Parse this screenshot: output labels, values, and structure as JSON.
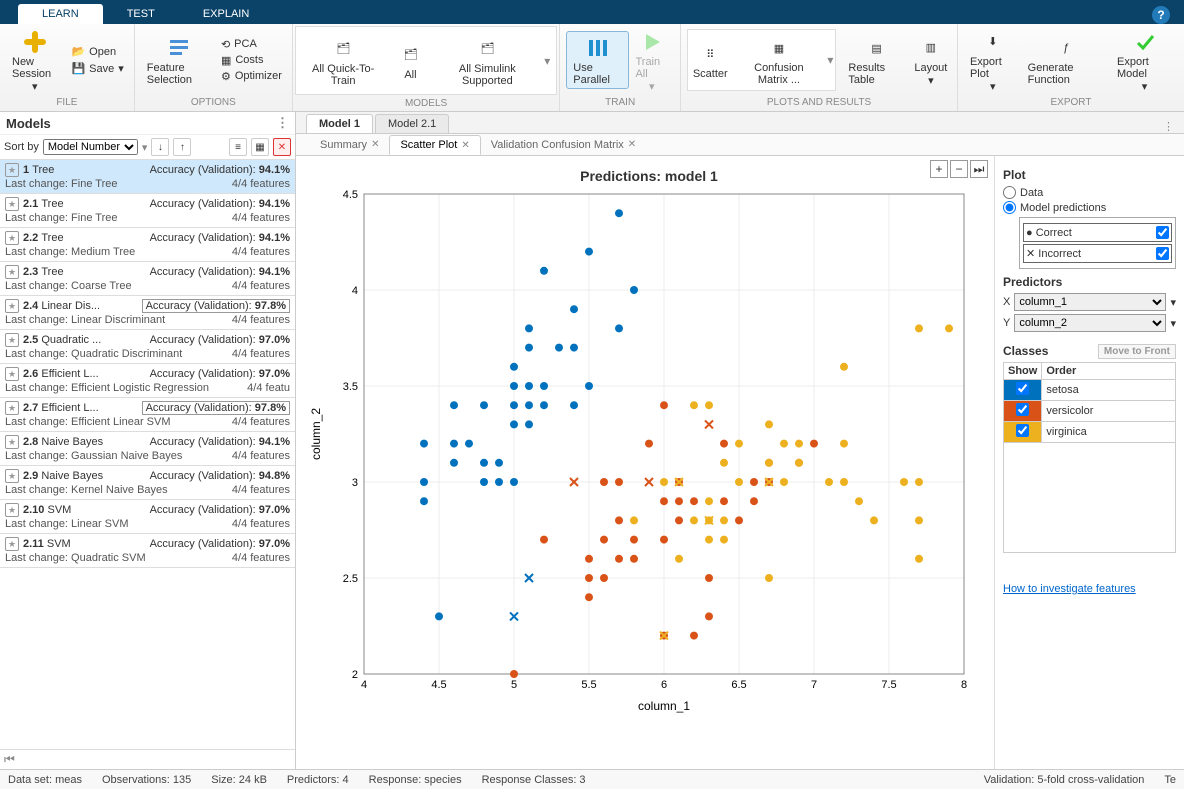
{
  "tabs": {
    "learn": "LEARN",
    "test": "TEST",
    "explain": "EXPLAIN"
  },
  "ribbon": {
    "file": {
      "new": "New Session",
      "open": "Open",
      "save": "Save",
      "label": "FILE"
    },
    "options": {
      "feature": "Feature Selection",
      "pca": "PCA",
      "costs": "Costs",
      "optimizer": "Optimizer",
      "label": "OPTIONS"
    },
    "models": {
      "all_quick": "All Quick-To-Train",
      "all": "All",
      "all_sim": "All Simulink Supported",
      "label": "MODELS"
    },
    "train": {
      "use_parallel": "Use Parallel",
      "train_all": "Train All",
      "label": "TRAIN"
    },
    "plots": {
      "scatter": "Scatter",
      "confusion": "Confusion Matrix  ...",
      "results": "Results Table",
      "layout": "Layout",
      "label": "PLOTS AND RESULTS"
    },
    "export": {
      "export_plot": "Export Plot",
      "gen_fn": "Generate Function",
      "export_model": "Export Model",
      "label": "EXPORT"
    }
  },
  "models_pane": {
    "title": "Models",
    "sort_label": "Sort by",
    "sort_value": "Model Number",
    "items": [
      {
        "id": "1",
        "name": "Tree",
        "acc": "94.1%",
        "last": "Fine Tree",
        "feat": "4/4 features",
        "sel": true,
        "box": false
      },
      {
        "id": "2.1",
        "name": "Tree",
        "acc": "94.1%",
        "last": "Fine Tree",
        "feat": "4/4 features",
        "box": false
      },
      {
        "id": "2.2",
        "name": "Tree",
        "acc": "94.1%",
        "last": "Medium Tree",
        "feat": "4/4 features",
        "box": false
      },
      {
        "id": "2.3",
        "name": "Tree",
        "acc": "94.1%",
        "last": "Coarse Tree",
        "feat": "4/4 features",
        "box": false
      },
      {
        "id": "2.4",
        "name": "Linear Dis...",
        "acc": "97.8%",
        "last": "Linear Discriminant",
        "feat": "4/4 features",
        "box": true
      },
      {
        "id": "2.5",
        "name": "Quadratic ...",
        "acc": "97.0%",
        "last": "Quadratic Discriminant",
        "feat": "4/4 features",
        "box": false
      },
      {
        "id": "2.6",
        "name": "Efficient L...",
        "acc": "97.0%",
        "last": "Efficient Logistic Regression",
        "feat": "4/4 featu",
        "box": false
      },
      {
        "id": "2.7",
        "name": "Efficient L...",
        "acc": "97.8%",
        "last": "Efficient Linear SVM",
        "feat": "4/4 features",
        "box": true
      },
      {
        "id": "2.8",
        "name": "Naive Bayes",
        "acc": "94.1%",
        "last": "Gaussian Naive Bayes",
        "feat": "4/4 features",
        "box": false
      },
      {
        "id": "2.9",
        "name": "Naive Bayes",
        "acc": "94.8%",
        "last": "Kernel Naive Bayes",
        "feat": "4/4 features",
        "box": false
      },
      {
        "id": "2.10",
        "name": "SVM",
        "acc": "97.0%",
        "last": "Linear SVM",
        "feat": "4/4 features",
        "box": false
      },
      {
        "id": "2.11",
        "name": "SVM",
        "acc": "97.0%",
        "last": "Quadratic SVM",
        "feat": "4/4 features",
        "box": false
      }
    ],
    "acc_prefix": "Accuracy (Validation): ",
    "last_prefix": "Last change: "
  },
  "doc_tabs": [
    "Model 1",
    "Model 2.1"
  ],
  "sub_tabs": [
    "Summary",
    "Scatter Plot",
    "Validation Confusion Matrix"
  ],
  "plot": {
    "title": "Predictions: model 1",
    "xlabel": "column_1",
    "ylabel": "column_2"
  },
  "side": {
    "plot_h": "Plot",
    "opt_data": "Data",
    "opt_pred": "Model predictions",
    "correct": "Correct",
    "incorrect": "Incorrect",
    "pred_h": "Predictors",
    "x": "X",
    "x_val": "column_1",
    "y": "Y",
    "y_val": "column_2",
    "classes_h": "Classes",
    "mtf": "Move to Front",
    "th_show": "Show",
    "th_order": "Order",
    "classes": [
      {
        "name": "setosa",
        "color": "#0072BD"
      },
      {
        "name": "versicolor",
        "color": "#D95319"
      },
      {
        "name": "virginica",
        "color": "#EDB120"
      }
    ],
    "link": "How to investigate features"
  },
  "status": {
    "dataset": "Data set: meas",
    "obs": "Observations: 135",
    "size": "Size: 24 kB",
    "pred": "Predictors: 4",
    "resp": "Response: species",
    "rclasses": "Response Classes: 3",
    "validation": "Validation: 5-fold cross-validation",
    "trail": "Te"
  },
  "chart_data": {
    "type": "scatter",
    "xlabel": "column_1",
    "ylabel": "column_2",
    "xlim": [
      4,
      8
    ],
    "ylim": [
      2,
      4.5
    ],
    "xticks": [
      4,
      4.5,
      5,
      5.5,
      6,
      6.5,
      7,
      7.5,
      8
    ],
    "yticks": [
      2,
      2.5,
      3,
      3.5,
      4,
      4.5
    ],
    "series": [
      {
        "name": "setosa-correct",
        "class": "setosa",
        "marker": "o",
        "color": "#0072BD",
        "points": [
          [
            4.4,
            2.9
          ],
          [
            4.4,
            3.0
          ],
          [
            4.4,
            3.2
          ],
          [
            4.5,
            2.3
          ],
          [
            4.6,
            3.1
          ],
          [
            4.6,
            3.2
          ],
          [
            4.6,
            3.4
          ],
          [
            4.7,
            3.2
          ],
          [
            4.8,
            3.0
          ],
          [
            4.8,
            3.1
          ],
          [
            4.8,
            3.4
          ],
          [
            4.9,
            3.0
          ],
          [
            4.9,
            3.1
          ],
          [
            5.0,
            3.0
          ],
          [
            5.0,
            3.3
          ],
          [
            5.0,
            3.4
          ],
          [
            5.0,
            3.5
          ],
          [
            5.0,
            3.6
          ],
          [
            5.1,
            3.3
          ],
          [
            5.1,
            3.4
          ],
          [
            5.1,
            3.5
          ],
          [
            5.1,
            3.7
          ],
          [
            5.1,
            3.8
          ],
          [
            5.2,
            3.4
          ],
          [
            5.2,
            3.5
          ],
          [
            5.2,
            4.1
          ],
          [
            5.3,
            3.7
          ],
          [
            5.4,
            3.4
          ],
          [
            5.4,
            3.7
          ],
          [
            5.4,
            3.9
          ],
          [
            5.5,
            3.5
          ],
          [
            5.5,
            4.2
          ],
          [
            5.7,
            3.8
          ],
          [
            5.7,
            4.4
          ],
          [
            5.8,
            4.0
          ]
        ]
      },
      {
        "name": "setosa-incorrect",
        "class": "setosa",
        "marker": "x",
        "color": "#0072BD",
        "points": [
          [
            5.0,
            2.3
          ],
          [
            5.1,
            2.5
          ]
        ]
      },
      {
        "name": "versicolor-correct",
        "class": "versicolor",
        "marker": "o",
        "color": "#D95319",
        "points": [
          [
            5.0,
            2.0
          ],
          [
            5.2,
            2.7
          ],
          [
            5.5,
            2.4
          ],
          [
            5.5,
            2.5
          ],
          [
            5.5,
            2.6
          ],
          [
            5.6,
            2.5
          ],
          [
            5.6,
            2.7
          ],
          [
            5.6,
            3.0
          ],
          [
            5.7,
            2.6
          ],
          [
            5.7,
            2.8
          ],
          [
            5.7,
            3.0
          ],
          [
            5.8,
            2.6
          ],
          [
            5.8,
            2.7
          ],
          [
            5.9,
            3.2
          ],
          [
            6.0,
            2.2
          ],
          [
            6.0,
            2.7
          ],
          [
            6.0,
            2.9
          ],
          [
            6.0,
            3.4
          ],
          [
            6.1,
            2.8
          ],
          [
            6.1,
            2.9
          ],
          [
            6.1,
            3.0
          ],
          [
            6.2,
            2.2
          ],
          [
            6.2,
            2.9
          ],
          [
            6.3,
            2.3
          ],
          [
            6.3,
            2.5
          ],
          [
            6.4,
            2.9
          ],
          [
            6.4,
            3.2
          ],
          [
            6.5,
            2.8
          ],
          [
            6.6,
            2.9
          ],
          [
            6.6,
            3.0
          ],
          [
            6.7,
            3.0
          ],
          [
            6.7,
            3.1
          ],
          [
            6.9,
            3.1
          ],
          [
            7.0,
            3.2
          ]
        ]
      },
      {
        "name": "versicolor-incorrect",
        "class": "versicolor",
        "marker": "x",
        "color": "#D95319",
        "points": [
          [
            5.9,
            3.0
          ],
          [
            6.3,
            3.3
          ],
          [
            5.4,
            3.0
          ]
        ]
      },
      {
        "name": "virginica-correct",
        "class": "virginica",
        "marker": "o",
        "color": "#EDB120",
        "points": [
          [
            5.8,
            2.8
          ],
          [
            6.0,
            3.0
          ],
          [
            6.1,
            2.6
          ],
          [
            6.2,
            2.8
          ],
          [
            6.2,
            3.4
          ],
          [
            6.3,
            2.7
          ],
          [
            6.3,
            2.8
          ],
          [
            6.3,
            2.9
          ],
          [
            6.3,
            3.4
          ],
          [
            6.4,
            2.7
          ],
          [
            6.4,
            2.8
          ],
          [
            6.4,
            3.1
          ],
          [
            6.5,
            3.0
          ],
          [
            6.5,
            3.2
          ],
          [
            6.7,
            2.5
          ],
          [
            6.7,
            3.1
          ],
          [
            6.7,
            3.3
          ],
          [
            6.8,
            3.0
          ],
          [
            6.8,
            3.2
          ],
          [
            6.9,
            3.1
          ],
          [
            6.9,
            3.2
          ],
          [
            7.1,
            3.0
          ],
          [
            7.2,
            3.0
          ],
          [
            7.2,
            3.2
          ],
          [
            7.2,
            3.6
          ],
          [
            7.3,
            2.9
          ],
          [
            7.4,
            2.8
          ],
          [
            7.6,
            3.0
          ],
          [
            7.7,
            2.6
          ],
          [
            7.7,
            2.8
          ],
          [
            7.7,
            3.0
          ],
          [
            7.7,
            3.8
          ],
          [
            7.9,
            3.8
          ]
        ]
      },
      {
        "name": "virginica-incorrect",
        "class": "virginica",
        "marker": "x",
        "color": "#EDB120",
        "points": [
          [
            6.0,
            2.2
          ],
          [
            6.1,
            3.0
          ],
          [
            6.7,
            3.0
          ],
          [
            6.3,
            2.8
          ]
        ]
      }
    ]
  }
}
